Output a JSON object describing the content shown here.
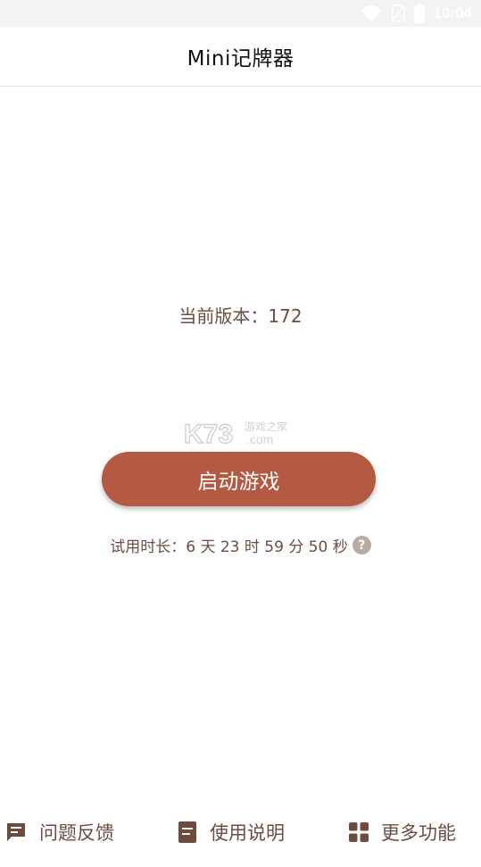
{
  "status_bar": {
    "time": "10:04"
  },
  "header": {
    "title": "Mini记牌器"
  },
  "main": {
    "version_text": "当前版本：172",
    "launch_button_label": "启动游戏",
    "trial_text": "试用时长：6 天 23 时 59 分 50 秒",
    "help_icon_glyph": "?"
  },
  "watermark": {
    "logo_text": "K73",
    "site_text": "游戏之家",
    "domain_text": ".com"
  },
  "bottom_nav": {
    "feedback": {
      "label": "问题反馈",
      "icon": "chat-icon"
    },
    "guide": {
      "label": "使用说明",
      "icon": "document-icon"
    },
    "more": {
      "label": "更多功能",
      "icon": "grid-icon"
    }
  },
  "colors": {
    "accent": "#b45a43",
    "text_brown": "#6d4c41",
    "icon_brown": "#6f4b3e",
    "help_icon_bg": "#b9aaa3",
    "status_bar_bg": "#f3f3f3"
  }
}
